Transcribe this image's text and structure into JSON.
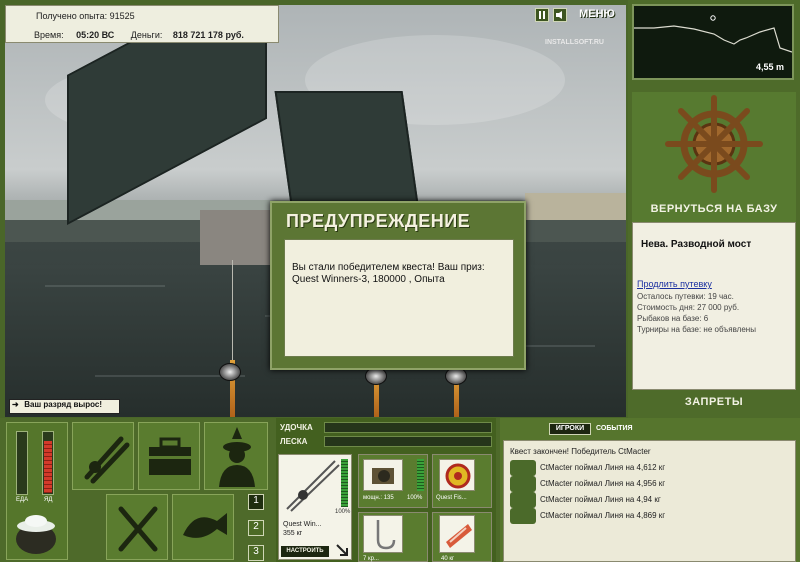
{
  "stats": {
    "experience_label": "Получено опыта:",
    "experience_value": "91525",
    "time_label": "Время:",
    "time_value": "05:20 ВС",
    "money_label": "Деньги:",
    "money_value": "818 721 178 руб."
  },
  "top_controls": {
    "pause_icon": "pause-icon",
    "sound_icon": "sound-icon",
    "menu_label": "МЕНЮ"
  },
  "watermark": "INSTALLSOFT.RU",
  "depth": {
    "value": "4,55 m"
  },
  "base": {
    "return_label": "ВЕРНУТЬСЯ НА БАЗУ",
    "location_name": "Нева. Разводной мост",
    "extend_trip_link": "Продлить путевку",
    "trip_remaining": "Осталось путевки: 19 час.",
    "day_cost": "Стоимость дня: 27 000 руб.",
    "fishers_on_base": "Рыбаков на базе: 6",
    "tournaments": "Турниры на базе: не объявлены",
    "bans_label": "ЗАПРЕТЫ"
  },
  "dialog": {
    "title": "ПРЕДУПРЕЖДЕНИЕ",
    "message": "Вы стали победителем квеста! Ваш приз: Quest Winners-3, 180000 , Опыта"
  },
  "toast": {
    "text": "Ваш разряд вырос!"
  },
  "meters": {
    "food_label": "ЕДА",
    "poison_label": "ЯД",
    "food_level": 0.0,
    "poison_level": 0.85
  },
  "side_numbers": [
    "1",
    "2",
    "3"
  ],
  "gear": {
    "rod_label": "УДОЧКА",
    "line_label": "ЛЕСКА",
    "rod_name": "Quest Win...",
    "rod_weight": "355 кг",
    "rod_percent": "100%",
    "reel_caption": "мощн.: 135",
    "reel_percent": "100%",
    "line_name": "Quest Fis...",
    "hook_caption": "7 кр...",
    "bait_caption": "40 кг",
    "setup_button": "НАСТРОИТЬ"
  },
  "events": {
    "tab_players": "ИГРОКИ",
    "tab_events": "СОБЫТИЯ",
    "rows": [
      "Квест закончен! Победитель CtMacter",
      "CtMacter поймал Линя на 4,612 кг",
      "CtMacter поймал Линя на 4,956 кг",
      "CtMacter поймал Линя на 4,94 кг",
      "CtMacter поймал Линя на 4,869 кг"
    ]
  },
  "colors": {
    "panel": "#4e6a2a",
    "accent": "#f1efde",
    "poison_fill": "#d23a2a"
  }
}
